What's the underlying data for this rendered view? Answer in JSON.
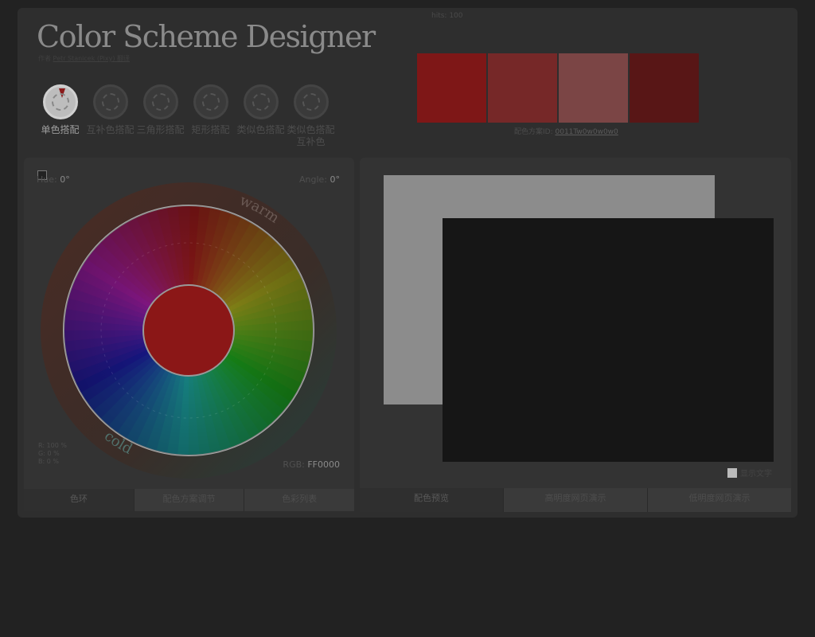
{
  "header": {
    "hits": "hits: 100",
    "title": "Color Scheme Designer",
    "byline_prefix": "作者",
    "byline_author": "Petr Stanicek (Pixy) 翻译"
  },
  "scheme_types": [
    {
      "label": "单色搭配",
      "active": true
    },
    {
      "label": "互补色搭配",
      "active": false
    },
    {
      "label": "三角形搭配",
      "active": false
    },
    {
      "label": "矩形搭配",
      "active": false
    },
    {
      "label": "类似色搭配",
      "active": false
    },
    {
      "label": "类似色搭配互补色",
      "active": false
    }
  ],
  "palette": {
    "colors": [
      "#7e1717",
      "#762828",
      "#7b4545",
      "#581616"
    ],
    "id_label": "配色方案ID:",
    "id_value": "0011Tw0w0w0w0"
  },
  "wheel": {
    "hue_label": "Hue:",
    "hue_value": "0°",
    "angle_label": "Angle:",
    "angle_value": "0°",
    "warm_label": "warm",
    "cold_label": "cold",
    "center_color": "#8b1717",
    "perc_r": "R: 100 %",
    "perc_g": "G:     0 %",
    "perc_b": "B:     0 %",
    "rgb_label": "RGB:",
    "rgb_value": "FF0000",
    "tabs": [
      "色环",
      "配色方案调节",
      "色彩列表"
    ]
  },
  "preview": {
    "show_text_label": "显示文字",
    "tabs": [
      "配色预览",
      "高明度网页演示",
      "低明度网页演示"
    ]
  }
}
